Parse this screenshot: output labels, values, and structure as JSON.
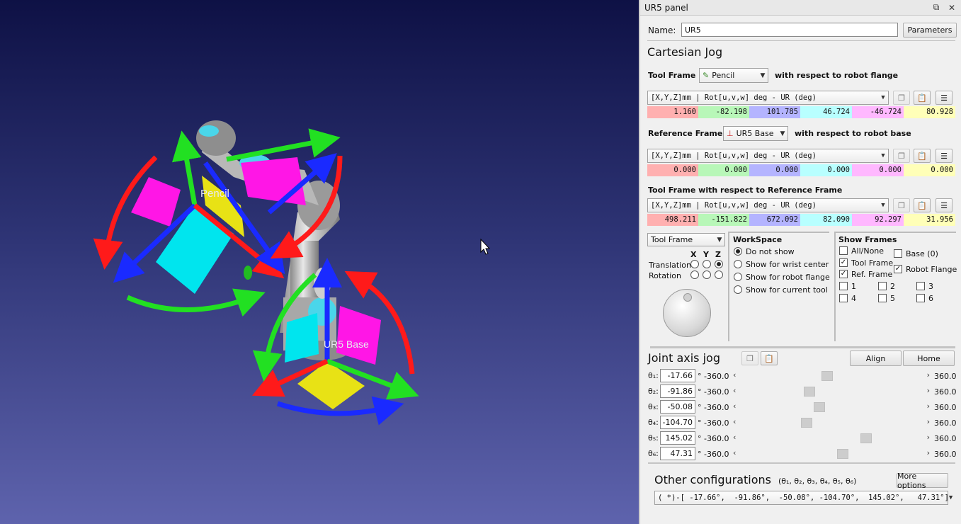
{
  "viewport": {
    "tool_label": "Pencil",
    "base_label": "UR5 Base"
  },
  "panel": {
    "title": "UR5 panel",
    "name_label": "Name:",
    "name_value": "UR5",
    "parameters_button": "Parameters",
    "cartesian_title": "Cartesian Jog",
    "tool_frame_label": "Tool Frame",
    "tool_frame_value": "Pencil",
    "wrt_flange": "with respect to robot flange",
    "pose_format": "[X,Y,Z]mm | Rot[u,v,w] deg  - UR (deg)",
    "tool_values": [
      "1.160",
      "-82.198",
      "101.785",
      "46.724",
      "-46.724",
      "80.928"
    ],
    "ref_frame_label": "Reference Frame",
    "ref_frame_value": "UR5 Base",
    "wrt_base": "with respect to robot base",
    "ref_values": [
      "0.000",
      "0.000",
      "0.000",
      "0.000",
      "0.000",
      "0.000"
    ],
    "tool_wrt_ref_label": "Tool Frame with respect to Reference Frame",
    "tool_ref_values": [
      "498.211",
      "-151.822",
      "672.092",
      "82.090",
      "92.297",
      "31.956"
    ],
    "value_colors": [
      "#ffb0b0",
      "#b8f7b8",
      "#b4b4ff",
      "#b8ffff",
      "#ffb8ff",
      "#ffffb8"
    ],
    "jog_frame_select": "Tool Frame",
    "axes": {
      "x": "X",
      "y": "Y",
      "z": "Z"
    },
    "translation_label": "Translation",
    "rotation_label": "Rotation",
    "workspace_title": "WorkSpace",
    "workspace_options": [
      "Do not show",
      "Show for wrist center",
      "Show for robot flange",
      "Show for current tool"
    ],
    "workspace_selected": 0,
    "show_frames_title": "Show Frames",
    "frames": {
      "all_none": "All/None",
      "base": "Base (0)",
      "tool_frame": "Tool Frame",
      "robot_flange": "Robot Flange",
      "ref_frame": "Ref. Frame",
      "j1": "1",
      "j2": "2",
      "j3": "3",
      "j4": "4",
      "j5": "5",
      "j6": "6"
    },
    "joint_title": "Joint axis jog",
    "align_button": "Align",
    "home_button": "Home",
    "joints": [
      {
        "label": "θ₁:",
        "value": "-17.66",
        "min": "° -360.0",
        "max": "360.0",
        "pos": 0.476
      },
      {
        "label": "θ₂:",
        "value": "-91.86",
        "min": "° -360.0",
        "max": "360.0",
        "pos": 0.372
      },
      {
        "label": "θ₃:",
        "value": "-50.08",
        "min": "° -360.0",
        "max": "360.0",
        "pos": 0.43
      },
      {
        "label": "θ₄:",
        "value": "-104.70",
        "min": "° -360.0",
        "max": "360.0",
        "pos": 0.355
      },
      {
        "label": "θ₅:",
        "value": "145.02",
        "min": "° -360.0",
        "max": "360.0",
        "pos": 0.701
      },
      {
        "label": "θ₆:",
        "value": "47.31",
        "min": "° -360.0",
        "max": "360.0",
        "pos": 0.566
      }
    ],
    "other_config_title": "Other configurations",
    "other_config_vars": "(θ₁, θ₂, θ₃, θ₄, θ₅, θ₆)",
    "more_options_button": "More options",
    "config_value": "( *)-[ -17.66°,  -91.86°,  -50.08°, -104.70°,  145.02°,   47.31°]"
  }
}
